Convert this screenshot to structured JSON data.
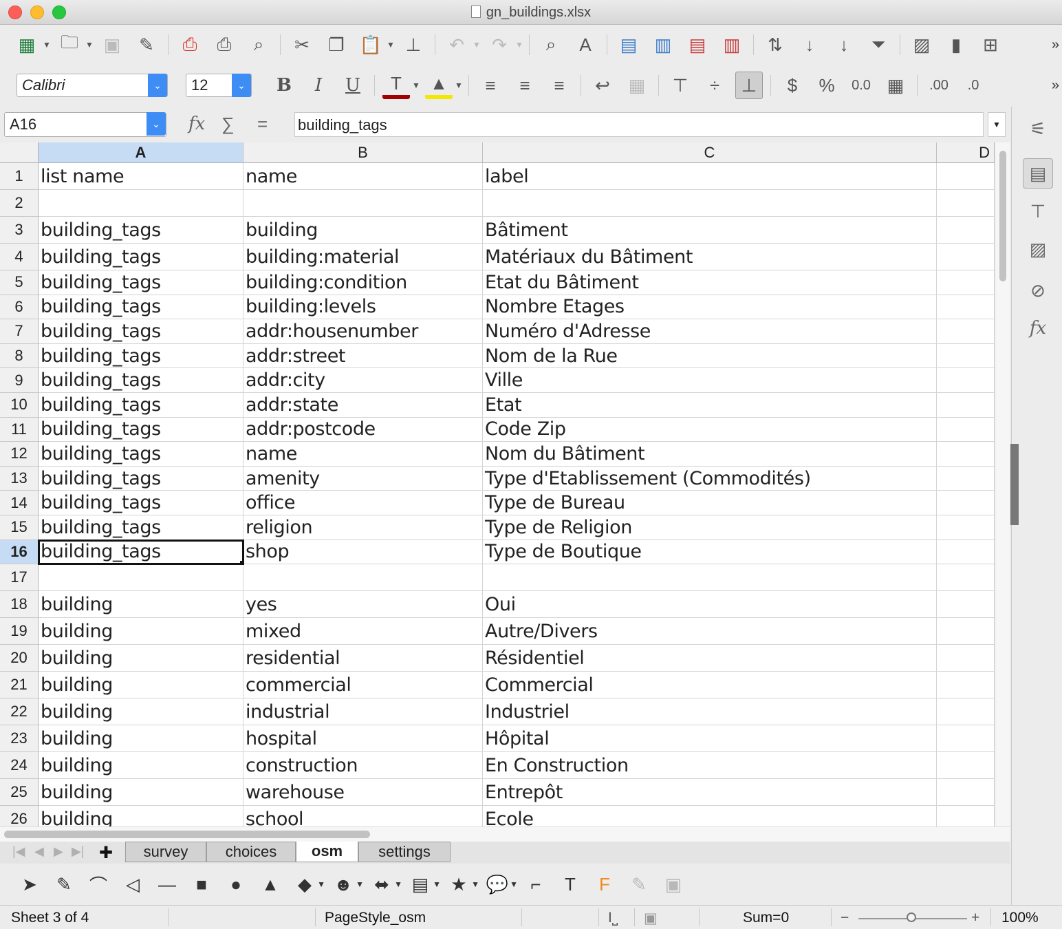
{
  "window": {
    "title": "gn_buildings.xlsx"
  },
  "font": {
    "name": "Calibri",
    "size": "12"
  },
  "formula": {
    "cell_ref": "A16",
    "content": "building_tags"
  },
  "columns": [
    "A",
    "B",
    "C",
    "D"
  ],
  "rows": [
    {
      "num": "1",
      "a": "list name",
      "b": "name",
      "c": "label"
    },
    {
      "num": "2",
      "a": "",
      "b": "",
      "c": ""
    },
    {
      "num": "3",
      "a": "building_tags",
      "b": "building",
      "c": "Bâtiment"
    },
    {
      "num": "4",
      "a": "building_tags",
      "b": "building:material",
      "c": "Matériaux du Bâtiment"
    },
    {
      "num": "5",
      "a": "building_tags",
      "b": "building:condition",
      "c": "Etat du Bâtiment"
    },
    {
      "num": "6",
      "a": "building_tags",
      "b": "building:levels",
      "c": "Nombre Etages"
    },
    {
      "num": "7",
      "a": "building_tags",
      "b": "addr:housenumber",
      "c": "Numéro d'Adresse"
    },
    {
      "num": "8",
      "a": "building_tags",
      "b": "addr:street",
      "c": "Nom de la Rue"
    },
    {
      "num": "9",
      "a": "building_tags",
      "b": "addr:city",
      "c": "Ville"
    },
    {
      "num": "10",
      "a": "building_tags",
      "b": "addr:state",
      "c": "Etat"
    },
    {
      "num": "11",
      "a": "building_tags",
      "b": "addr:postcode",
      "c": "Code Zip"
    },
    {
      "num": "12",
      "a": "building_tags",
      "b": "name",
      "c": "Nom du Bâtiment"
    },
    {
      "num": "13",
      "a": "building_tags",
      "b": "amenity",
      "c": "Type d'Etablissement (Commodités)"
    },
    {
      "num": "14",
      "a": "building_tags",
      "b": "office",
      "c": "Type de Bureau"
    },
    {
      "num": "15",
      "a": "building_tags",
      "b": "religion",
      "c": "Type de Religion"
    },
    {
      "num": "16",
      "a": "building_tags",
      "b": "shop",
      "c": "Type de Boutique"
    },
    {
      "num": "17",
      "a": "",
      "b": "",
      "c": ""
    },
    {
      "num": "18",
      "a": "building",
      "b": "yes",
      "c": "Oui"
    },
    {
      "num": "19",
      "a": "building",
      "b": "mixed",
      "c": "Autre/Divers"
    },
    {
      "num": "20",
      "a": "building",
      "b": "residential",
      "c": "Résidentiel"
    },
    {
      "num": "21",
      "a": "building",
      "b": "commercial",
      "c": "Commercial"
    },
    {
      "num": "22",
      "a": "building",
      "b": "industrial",
      "c": "Industriel"
    },
    {
      "num": "23",
      "a": "building",
      "b": "hospital",
      "c": "Hôpital"
    },
    {
      "num": "24",
      "a": "building",
      "b": "construction",
      "c": "En Construction"
    },
    {
      "num": "25",
      "a": "building",
      "b": "warehouse",
      "c": "Entrepôt"
    },
    {
      "num": "26",
      "a": "building",
      "b": "school",
      "c": "Ecole"
    }
  ],
  "selection": {
    "row": "16",
    "column": "A"
  },
  "sheets": [
    "survey",
    "choices",
    "osm",
    "settings"
  ],
  "active_sheet": "osm",
  "status": {
    "sheet": "Sheet 3 of 4",
    "page_style": "PageStyle_osm",
    "sum": "Sum=0",
    "zoom": "100%"
  },
  "colors": {
    "accent": "#3d8df5",
    "selection": "#c6dcf5",
    "font_color": "#a10000",
    "highlight": "#f4e800"
  }
}
